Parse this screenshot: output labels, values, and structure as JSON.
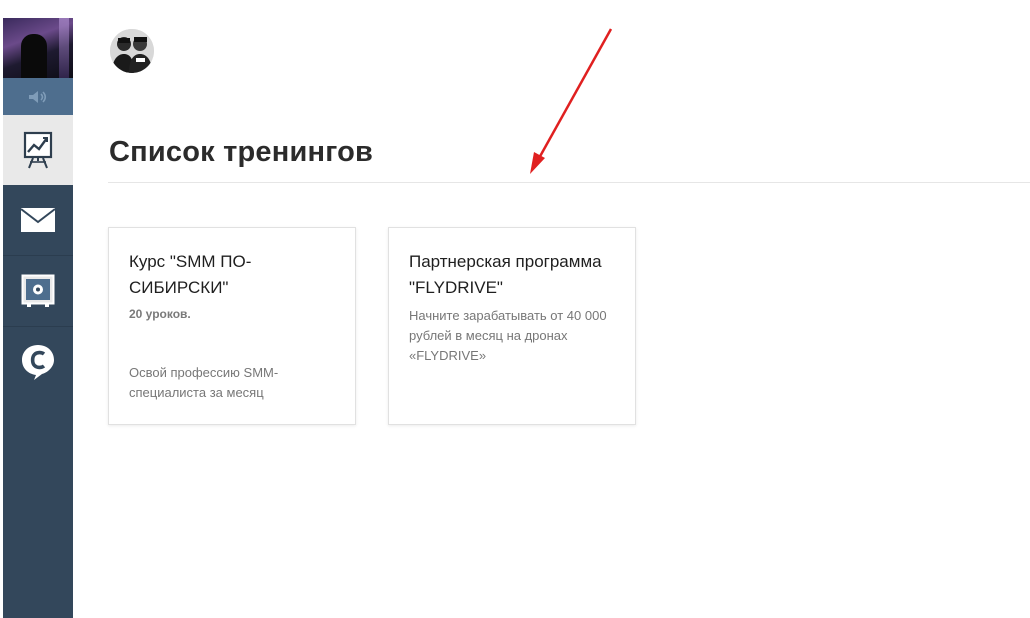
{
  "sidebar": {
    "items": [
      {
        "name": "trainings",
        "icon": "presentation-chart-icon",
        "active": true
      },
      {
        "name": "messages",
        "icon": "envelope-icon",
        "active": false
      },
      {
        "name": "safe",
        "icon": "safe-icon",
        "active": false
      },
      {
        "name": "brand",
        "icon": "speech-c-logo-icon",
        "active": false
      }
    ],
    "sound_icon": "speaker-icon"
  },
  "main": {
    "title": "Список тренингов",
    "cards": [
      {
        "title": "Курс \"SMM ПО-СИБИРСКИ\"",
        "count": "20 уроков.",
        "description": "Освой профессию SMM-специалиста за месяц"
      },
      {
        "title": "Партнерская программа \"FLYDRIVE\"",
        "description": "Начните зарабатывать от 40 000 рублей в месяц на дронах «FLYDRIVE»"
      }
    ]
  },
  "annotation": {
    "arrow_color": "#e02020"
  },
  "colors": {
    "sidebar": "#33475b",
    "active_item": "#e9e9e9"
  }
}
